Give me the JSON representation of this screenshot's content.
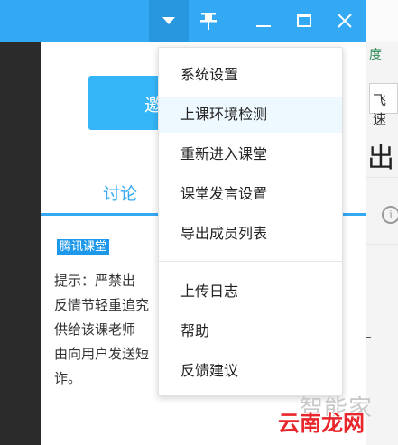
{
  "titlebar": {
    "icons": [
      "dropdown-arrow-icon",
      "pin-icon",
      "minimize-icon",
      "maximize-icon",
      "close-icon"
    ],
    "accent": "#33a9f4"
  },
  "panel": {
    "invite_label": "邀",
    "tab_label": "讨论",
    "badge": "腾讯课堂",
    "notice_lines": [
      "提示：严禁出",
      "反情节轻重追究",
      "供给该课老师",
      "由向用户发送短",
      "诈。"
    ]
  },
  "menu": {
    "items": [
      "系统设置",
      "上课环境检测",
      "重新进入课堂",
      "课堂发言设置",
      "导出成员列表",
      "上传日志",
      "帮助",
      "反馈建议"
    ]
  },
  "background_right": {
    "link_text": "度",
    "search_text": "飞速",
    "heading_text": "出",
    "info_glyph": "i"
  },
  "watermark": {
    "faint": "智能家",
    "main": "云南龙网"
  }
}
